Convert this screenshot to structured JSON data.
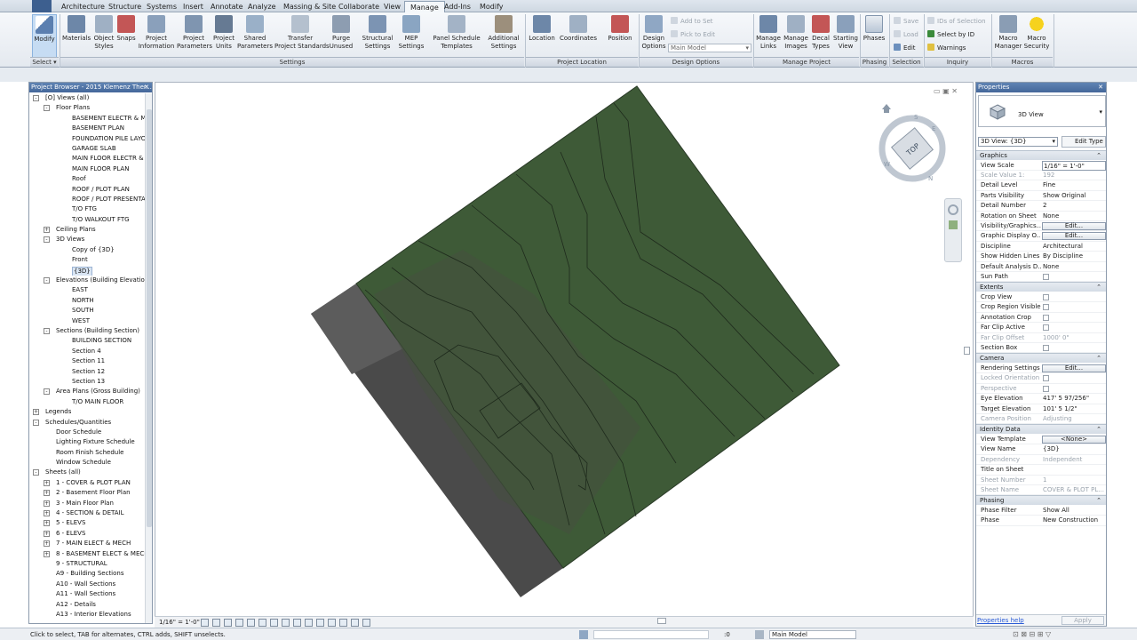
{
  "tabs": [
    "Architecture",
    "Structure",
    "Systems",
    "Insert",
    "Annotate",
    "Analyze",
    "Massing & Site",
    "Collaborate",
    "View",
    "Manage",
    "Add-Ins",
    "Modify"
  ],
  "active_tab": "Manage",
  "ribbon": {
    "modify": "Modify",
    "select": "Select",
    "settings": {
      "title": "Settings",
      "items": [
        {
          "label": "Materials",
          "icon": "materials-icon"
        },
        {
          "label": "Object\nStyles",
          "icon": "object-styles-icon"
        },
        {
          "label": "Snaps",
          "icon": "snaps-icon"
        },
        {
          "label": "Project\nInformation",
          "icon": "project-info-icon"
        },
        {
          "label": "Project\nParameters",
          "icon": "project-parameters-icon"
        },
        {
          "label": "Project\nUnits",
          "icon": "project-units-icon"
        },
        {
          "label": "Shared\nParameters",
          "icon": "shared-parameters-icon"
        },
        {
          "label": "Transfer\nProject Standards",
          "icon": "transfer-standards-icon"
        },
        {
          "label": "Purge\nUnused",
          "icon": "purge-icon"
        },
        {
          "label": "Structural\nSettings",
          "icon": "structural-settings-icon"
        },
        {
          "label": "MEP\nSettings",
          "icon": "mep-settings-icon"
        },
        {
          "label": "Panel Schedule\nTemplates",
          "icon": "panel-schedule-icon"
        },
        {
          "label": "Additional\nSettings",
          "icon": "additional-settings-icon"
        }
      ]
    },
    "location": {
      "title": "Project Location",
      "items": [
        {
          "label": "Location",
          "icon": "globe-icon"
        },
        {
          "label": "Coordinates",
          "icon": "coordinates-icon"
        },
        {
          "label": "Position",
          "icon": "position-icon"
        }
      ]
    },
    "design": {
      "title": "Design Options",
      "design_options": "Design\nOptions",
      "add_to_set": "Add to Set",
      "pick_to_edit": "Pick to Edit",
      "main_model": "Main Model"
    },
    "manage_project": {
      "title": "Manage Project",
      "items": [
        {
          "label": "Manage\nLinks",
          "icon": "links-icon"
        },
        {
          "label": "Manage\nImages",
          "icon": "images-icon"
        },
        {
          "label": "Decal\nTypes",
          "icon": "decal-icon"
        },
        {
          "label": "Starting\nView",
          "icon": "starting-view-icon"
        }
      ]
    },
    "phasing": {
      "title": "Phasing",
      "label": "Phases"
    },
    "selection": {
      "title": "Selection",
      "save": "Save",
      "load": "Load",
      "edit": "Edit"
    },
    "inquiry": {
      "title": "Inquiry",
      "ids": "IDs of Selection",
      "select_by_id": "Select  by ID",
      "warnings": "Warnings"
    },
    "macros": {
      "title": "Macros",
      "manager": "Macro\nManager",
      "security": "Macro\nSecurity"
    }
  },
  "project_browser": {
    "title": "Project Browser - 2015 Klemenz Ther...",
    "items": [
      {
        "l": 0,
        "t": "-",
        "text": "[O] Views (all)"
      },
      {
        "l": 1,
        "t": "-",
        "text": "Floor Plans"
      },
      {
        "l": 2,
        "t": "",
        "text": "BASEMENT ELECTR & ME"
      },
      {
        "l": 2,
        "t": "",
        "text": "BASEMENT PLAN"
      },
      {
        "l": 2,
        "t": "",
        "text": "FOUNDATION PILE LAYO"
      },
      {
        "l": 2,
        "t": "",
        "text": "GARAGE SLAB"
      },
      {
        "l": 2,
        "t": "",
        "text": "MAIN FLOOR ELECTR & M"
      },
      {
        "l": 2,
        "t": "",
        "text": "MAIN FLOOR PLAN"
      },
      {
        "l": 2,
        "t": "",
        "text": "Roof"
      },
      {
        "l": 2,
        "t": "",
        "text": "ROOF / PLOT PLAN"
      },
      {
        "l": 2,
        "t": "",
        "text": "ROOF / PLOT PRESENTAT"
      },
      {
        "l": 2,
        "t": "",
        "text": "T/O FTG"
      },
      {
        "l": 2,
        "t": "",
        "text": "T/O WALKOUT FTG"
      },
      {
        "l": 1,
        "t": "+",
        "text": "Ceiling Plans"
      },
      {
        "l": 1,
        "t": "-",
        "text": "3D Views"
      },
      {
        "l": 2,
        "t": "",
        "text": "Copy of {3D}"
      },
      {
        "l": 2,
        "t": "",
        "text": "Front"
      },
      {
        "l": 2,
        "t": "",
        "text": "{3D}",
        "hl": true
      },
      {
        "l": 1,
        "t": "-",
        "text": "Elevations (Building Elevation"
      },
      {
        "l": 2,
        "t": "",
        "text": "EAST"
      },
      {
        "l": 2,
        "t": "",
        "text": "NORTH"
      },
      {
        "l": 2,
        "t": "",
        "text": "SOUTH"
      },
      {
        "l": 2,
        "t": "",
        "text": "WEST"
      },
      {
        "l": 1,
        "t": "-",
        "text": "Sections (Building Section)"
      },
      {
        "l": 2,
        "t": "",
        "text": "BUILDING SECTION"
      },
      {
        "l": 2,
        "t": "",
        "text": "Section 4"
      },
      {
        "l": 2,
        "t": "",
        "text": "Section 11"
      },
      {
        "l": 2,
        "t": "",
        "text": "Section 12"
      },
      {
        "l": 2,
        "t": "",
        "text": "Section 13"
      },
      {
        "l": 1,
        "t": "-",
        "text": "Area Plans (Gross Building)"
      },
      {
        "l": 2,
        "t": "",
        "text": "T/O MAIN FLOOR"
      },
      {
        "l": 0,
        "t": "+",
        "text": "Legends"
      },
      {
        "l": 0,
        "t": "-",
        "text": "Schedules/Quantities"
      },
      {
        "l": 1,
        "t": "",
        "text": "Door Schedule"
      },
      {
        "l": 1,
        "t": "",
        "text": "Lighting Fixture Schedule"
      },
      {
        "l": 1,
        "t": "",
        "text": "Room Finish Schedule"
      },
      {
        "l": 1,
        "t": "",
        "text": "Window Schedule"
      },
      {
        "l": 0,
        "t": "-",
        "text": "Sheets (all)"
      },
      {
        "l": 1,
        "t": "+",
        "text": "1 - COVER & PLOT PLAN"
      },
      {
        "l": 1,
        "t": "+",
        "text": "2 - Basement Floor Plan"
      },
      {
        "l": 1,
        "t": "+",
        "text": "3 - Main Floor Plan"
      },
      {
        "l": 1,
        "t": "+",
        "text": "4 - SECTION & DETAIL"
      },
      {
        "l": 1,
        "t": "+",
        "text": "5 - ELEVS"
      },
      {
        "l": 1,
        "t": "+",
        "text": "6 - ELEVS"
      },
      {
        "l": 1,
        "t": "+",
        "text": "7 - MAIN ELECT & MECH"
      },
      {
        "l": 1,
        "t": "+",
        "text": "8 - BASEMENT ELECT & MECH"
      },
      {
        "l": 1,
        "t": "",
        "text": "9 - STRUCTURAL"
      },
      {
        "l": 1,
        "t": "",
        "text": "A9 - Building Sections"
      },
      {
        "l": 1,
        "t": "",
        "text": "A10 - Wall Sections"
      },
      {
        "l": 1,
        "t": "",
        "text": "A11 - Wall Sections"
      },
      {
        "l": 1,
        "t": "",
        "text": "A12 - Details"
      },
      {
        "l": 1,
        "t": "",
        "text": "A13 - Interior Elevations"
      }
    ]
  },
  "view": {
    "scale": "1/16\" = 1'-0\"",
    "viewcube_label": "TOP",
    "terrain_color": "#3e5a37"
  },
  "properties": {
    "title": "Properties",
    "type_name": "3D View",
    "filter": "3D View: {3D}",
    "edit_type": "Edit Type",
    "groups": [
      {
        "name": "Graphics",
        "rows": [
          {
            "k": "View Scale",
            "v": "1/16\" = 1'-0\"",
            "kind": "input"
          },
          {
            "k": "Scale Value    1:",
            "v": "192",
            "dim": true
          },
          {
            "k": "Detail Level",
            "v": "Fine"
          },
          {
            "k": "Parts Visibility",
            "v": "Show Original"
          },
          {
            "k": "Detail Number",
            "v": "2"
          },
          {
            "k": "Rotation on Sheet",
            "v": "None"
          },
          {
            "k": "Visibility/Graphics...",
            "v": "Edit...",
            "kind": "btn"
          },
          {
            "k": "Graphic Display O...",
            "v": "Edit...",
            "kind": "btn"
          },
          {
            "k": "Discipline",
            "v": "Architectural"
          },
          {
            "k": "Show Hidden Lines",
            "v": "By Discipline"
          },
          {
            "k": "Default Analysis D...",
            "v": "None"
          },
          {
            "k": "Sun Path",
            "v": "",
            "kind": "cb"
          }
        ]
      },
      {
        "name": "Extents",
        "rows": [
          {
            "k": "Crop View",
            "v": "",
            "kind": "cb"
          },
          {
            "k": "Crop Region Visible",
            "v": "",
            "kind": "cb"
          },
          {
            "k": "Annotation Crop",
            "v": "",
            "kind": "cb"
          },
          {
            "k": "Far Clip Active",
            "v": "",
            "kind": "cb"
          },
          {
            "k": "Far Clip Offset",
            "v": "1000'  0\"",
            "dim": true
          },
          {
            "k": "Section Box",
            "v": "",
            "kind": "cb"
          }
        ]
      },
      {
        "name": "Camera",
        "rows": [
          {
            "k": "Rendering Settings",
            "v": "Edit...",
            "kind": "btn"
          },
          {
            "k": "Locked Orientation",
            "v": "",
            "kind": "cb",
            "dim": true
          },
          {
            "k": "Perspective",
            "v": "",
            "kind": "cb",
            "dim": true
          },
          {
            "k": "Eye Elevation",
            "v": "417'  5 97/256\""
          },
          {
            "k": "Target Elevation",
            "v": "101'  5 1/2\""
          },
          {
            "k": "Camera Position",
            "v": "Adjusting",
            "dim": true
          }
        ]
      },
      {
        "name": "Identity Data",
        "rows": [
          {
            "k": "View Template",
            "v": "<None>",
            "kind": "btn"
          },
          {
            "k": "View Name",
            "v": "{3D}"
          },
          {
            "k": "Dependency",
            "v": "Independent",
            "dim": true
          },
          {
            "k": "Title on Sheet",
            "v": ""
          },
          {
            "k": "Sheet Number",
            "v": "1",
            "dim": true
          },
          {
            "k": "Sheet Name",
            "v": "COVER & PLOT PL...",
            "dim": true
          }
        ]
      },
      {
        "name": "Phasing",
        "rows": [
          {
            "k": "Phase Filter",
            "v": "Show All"
          },
          {
            "k": "Phase",
            "v": "New Construction"
          }
        ]
      }
    ],
    "help": "Properties help",
    "apply": "Apply"
  },
  "status": {
    "text": "Click to select, TAB for alternates, CTRL adds, SHIFT unselects.",
    "zero": ":0",
    "main_model": "Main Model"
  }
}
